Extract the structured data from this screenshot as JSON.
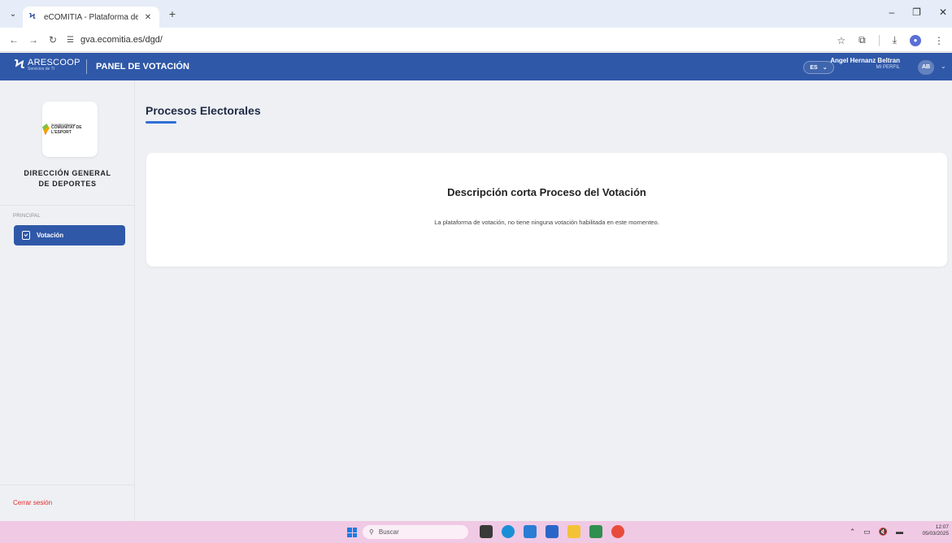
{
  "browser": {
    "tab_title": "eCOMITIA - Plataforma de Votac",
    "url": "gva.ecomitia.es/dgd/"
  },
  "header": {
    "logo_name": "ARESCOOP",
    "logo_sub": "Servicios de TI",
    "title": "PANEL DE VOTACIÓN",
    "lang": "ES",
    "user_name": "Angel Hernanz Beltran",
    "user_sub": "MI PERFIL",
    "avatar_initials": "AB"
  },
  "sidebar": {
    "org_logo_small": "Generalitat Valenciana",
    "org_logo_main": "COMUNITAT DE L'ESPORT",
    "org_name_line1": "DIRECCIÓN GENERAL",
    "org_name_line2": "DE DEPORTES",
    "section": "PRINCIPAL",
    "items": [
      {
        "label": "Votación",
        "active": true
      }
    ],
    "logout": "Cerrar sesión"
  },
  "main": {
    "page_title": "Procesos Electorales",
    "card_title": "Descripción corta Proceso del Votación",
    "card_desc": "La plataforma de votación, no tiene ninguna votación habilitada en este momenteo."
  },
  "taskbar": {
    "search_placeholder": "Buscar",
    "time": "12:07",
    "date": "05/03/2025"
  },
  "colors": {
    "primary": "#2f58a8",
    "accent_underline": "#2f6fd6",
    "logout": "#e02a2a",
    "taskbar": "#f0c9e4"
  }
}
